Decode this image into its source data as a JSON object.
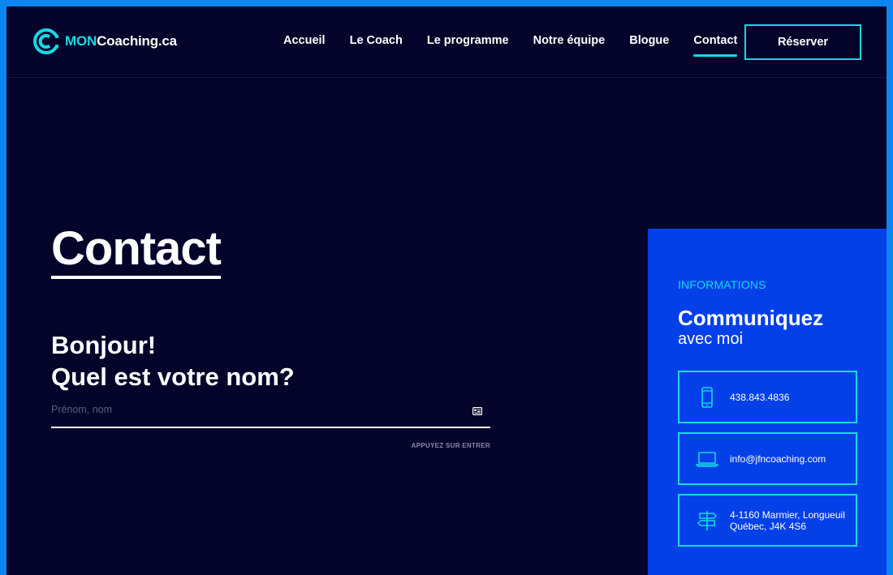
{
  "brand": {
    "prefix": "MON",
    "name": "Coaching.ca",
    "accent": "#15d9e6",
    "background": "#04032a",
    "panel": "#0440e8"
  },
  "nav": {
    "items": [
      {
        "label": "Accueil"
      },
      {
        "label": "Le Coach"
      },
      {
        "label": "Le programme"
      },
      {
        "label": "Notre équipe"
      },
      {
        "label": "Blogue"
      },
      {
        "label": "Contact",
        "active": true
      }
    ],
    "cta_label": "Réserver"
  },
  "main": {
    "title": "Contact",
    "question_line1": "Bonjour!",
    "question_line2": "Quel est votre nom?",
    "input_placeholder": "Prénom, nom",
    "input_value": "",
    "hint": "APPUYEZ SUR ENTRER"
  },
  "info": {
    "eyebrow": "INFORMATIONS",
    "title": "Communiquez",
    "subtitle": "avec moi",
    "phone": "438.843.4836",
    "email": "info@jfncoaching.com",
    "address_line1": "4-1160 Marmier, Longueuil",
    "address_line2": "Québec, J4K 4S6",
    "icons": [
      "phone-icon",
      "laptop-icon",
      "signpost-icon"
    ]
  }
}
